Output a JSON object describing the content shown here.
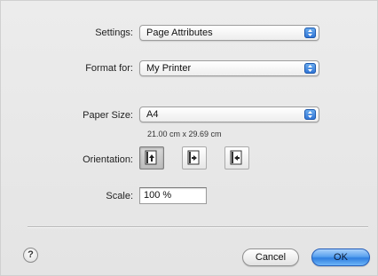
{
  "settings": {
    "label": "Settings:",
    "value": "Page Attributes"
  },
  "format_for": {
    "label": "Format for:",
    "value": "My Printer"
  },
  "paper_size": {
    "label": "Paper Size:",
    "value": "A4",
    "dimensions": "21.00 cm x 29.69 cm"
  },
  "orientation": {
    "label": "Orientation:",
    "options": [
      {
        "name": "portrait",
        "selected": true
      },
      {
        "name": "landscape-left",
        "selected": false
      },
      {
        "name": "landscape-right",
        "selected": false
      }
    ]
  },
  "scale": {
    "label": "Scale:",
    "value": "100 %"
  },
  "footer": {
    "help_symbol": "?",
    "cancel_label": "Cancel",
    "ok_label": "OK"
  },
  "colors": {
    "accent": "#2f7fe0",
    "window_bg": "#e8e8e8"
  }
}
